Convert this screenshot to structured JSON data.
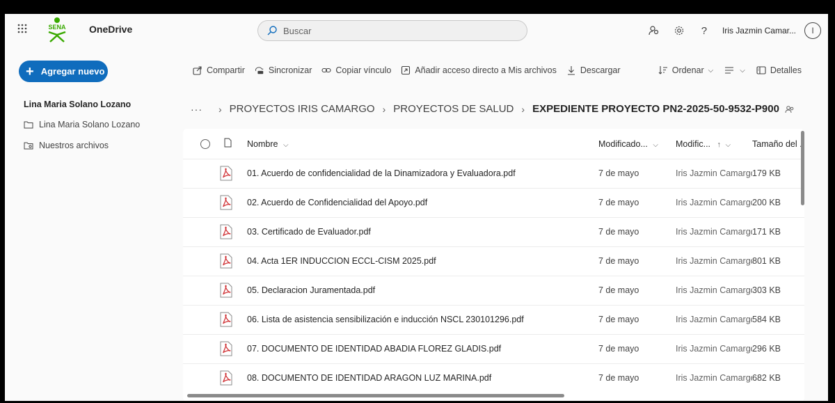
{
  "app": {
    "name": "OneDrive",
    "logo_text": "SENA"
  },
  "search": {
    "placeholder": "Buscar"
  },
  "user": {
    "name": "Iris Jazmin Camar...",
    "initial": "I"
  },
  "sidebar": {
    "add_button": "Agregar nuevo",
    "owner": "Lina Maria Solano Lozano",
    "items": [
      {
        "label": "Lina Maria Solano Lozano",
        "icon": "folder-icon"
      },
      {
        "label": "Nuestros archivos",
        "icon": "shared-folder-icon"
      }
    ]
  },
  "commands": {
    "share": "Compartir",
    "sync": "Sincronizar",
    "copy_link": "Copiar vínculo",
    "add_shortcut": "Añadir acceso directo a Mis archivos",
    "download": "Descargar",
    "sort": "Ordenar",
    "details": "Detalles"
  },
  "breadcrumb": {
    "more": "···",
    "items": [
      "PROYECTOS IRIS CAMARGO",
      "PROYECTOS DE SALUD"
    ],
    "current": "EXPEDIENTE PROYECTO PN2-2025-50-9532-P900"
  },
  "columns": {
    "name": "Nombre",
    "modified": "Modificado...",
    "modified_by": "Modific...",
    "size": "Tamaño del ."
  },
  "files": [
    {
      "name": "01. Acuerdo de confidencialidad de la Dinamizadora y Evaluadora.pdf",
      "modified": "7 de mayo",
      "modified_by": "Iris Jazmin Camargo",
      "size": "179 KB"
    },
    {
      "name": "02. Acuerdo de Confidencialidad del Apoyo.pdf",
      "modified": "7 de mayo",
      "modified_by": "Iris Jazmin Camargo",
      "size": "200 KB"
    },
    {
      "name": "03. Certificado de Evaluador.pdf",
      "modified": "7 de mayo",
      "modified_by": "Iris Jazmin Camargo",
      "size": "171 KB"
    },
    {
      "name": "04. Acta 1ER INDUCCION ECCL-CISM 2025.pdf",
      "modified": "7 de mayo",
      "modified_by": "Iris Jazmin Camargo",
      "size": "801 KB"
    },
    {
      "name": "05. Declaracion Juramentada.pdf",
      "modified": "7 de mayo",
      "modified_by": "Iris Jazmin Camargo",
      "size": "303 KB"
    },
    {
      "name": "06. Lista de asistencia sensibilización e inducción NSCL 230101296.pdf",
      "modified": "7 de mayo",
      "modified_by": "Iris Jazmin Camargo",
      "size": "584 KB"
    },
    {
      "name": "07. DOCUMENTO DE IDENTIDAD ABADIA FLOREZ GLADIS.pdf",
      "modified": "7 de mayo",
      "modified_by": "Iris Jazmin Camargo",
      "size": "296 KB"
    },
    {
      "name": "08. DOCUMENTO DE IDENTIDAD ARAGON LUZ MARINA.pdf",
      "modified": "7 de mayo",
      "modified_by": "Iris Jazmin Camargo",
      "size": "682 KB"
    }
  ],
  "colors": {
    "accent": "#0f6cbd",
    "pdf": "#d13438",
    "sena_green": "#39a900"
  }
}
